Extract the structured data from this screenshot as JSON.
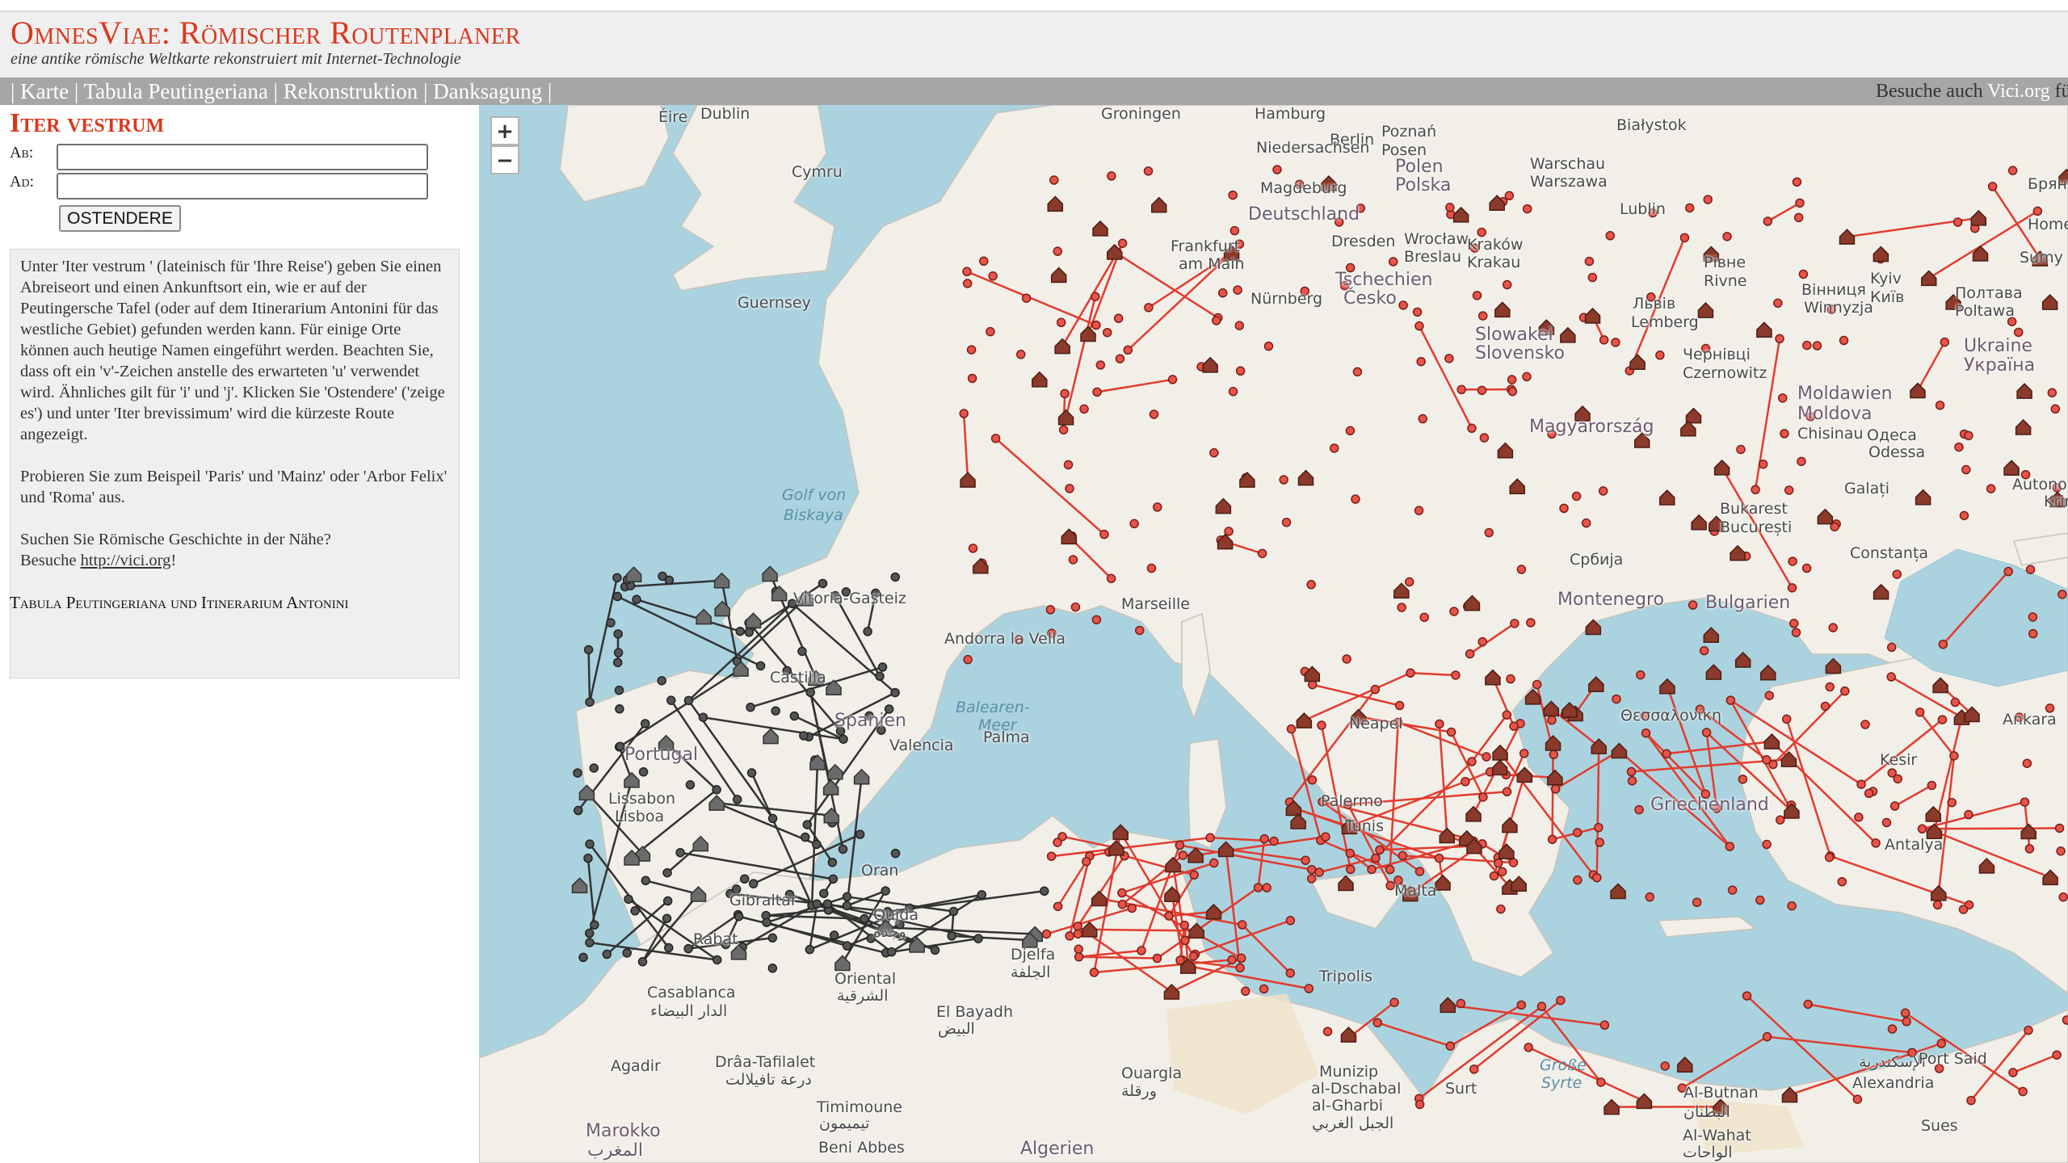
{
  "header": {
    "title": "OmnesViae: Römischer Routenplaner",
    "subtitle": "eine antike römische Weltkarte rekonstruiert mit Internet-Technologie"
  },
  "nav": {
    "separator": "|",
    "items": [
      "Karte",
      "Tabula Peutingeriana",
      "Rekonstruktion",
      "Danksagung"
    ],
    "right_text": "Besuche auch",
    "right_link": "Vici.org",
    "right_suffix": "fü"
  },
  "sidebar": {
    "heading": "Iter vestrum",
    "from_label": "Ab:",
    "to_label": "Ad:",
    "from_value": "",
    "to_value": "",
    "button": "OSTENDERE",
    "info_p1": "Unter 'Iter vestrum ' (lateinisch für 'Ihre Reise') geben Sie einen Abreiseort und einen Ankunftsort ein, wie er auf der Peutingersche Tafel (oder auf dem Itinerarium Antonini für das westliche Gebiet) gefunden werden kann. Für einige Orte können auch heutige Namen eingeführt werden. Beachten Sie, dass oft ein 'v'-Zeichen anstelle des erwarteten 'u' verwendet wird. Ähnliches gilt für 'i' und 'j'. Klicken Sie 'Ostendere' ('zeige es') und unter 'Iter brevissimum' wird die kürzeste Route angezeigt.",
    "info_p2": "Probieren Sie zum Beispeil 'Paris' und 'Mainz' oder 'Arbor Felix' und 'Roma' aus.",
    "info_p3a": "Suchen Sie Römische Geschichte in der Nähe?",
    "info_p3b": "Besuche",
    "info_link": "http://vici.org",
    "info_p3c": "!",
    "tabula_heading": "Tabula Peutingeriana und Itinerarium Antonini"
  },
  "map": {
    "zoom_in": "+",
    "zoom_out": "−",
    "colors": {
      "sea": "#aad3df",
      "land": "#f2efe9",
      "route": "#e23b2e",
      "station": "#c0392b",
      "ia_station": "#555555"
    },
    "labels": [
      {
        "text": "Éire"
      },
      {
        "text": "Dublin"
      },
      {
        "text": "Cymru"
      },
      {
        "text": "Groningen"
      },
      {
        "text": "Hamburg"
      },
      {
        "text": "Berlin"
      },
      {
        "text": "Poznań"
      },
      {
        "text": "Posen"
      },
      {
        "text": "Białystok"
      },
      {
        "text": "Niedersachsen"
      },
      {
        "text": "Magdeburg"
      },
      {
        "text": "Polen"
      },
      {
        "text": "Polska"
      },
      {
        "text": "Warschau"
      },
      {
        "text": "Warszawa"
      },
      {
        "text": "Deutschland"
      },
      {
        "text": "Dresden"
      },
      {
        "text": "Wrocław"
      },
      {
        "text": "Breslau"
      },
      {
        "text": "Lublin"
      },
      {
        "text": "Frankfurt"
      },
      {
        "text": "am Main"
      },
      {
        "text": "Kraków"
      },
      {
        "text": "Krakau"
      },
      {
        "text": "Nürnberg"
      },
      {
        "text": "Tschechien"
      },
      {
        "text": "Česko"
      },
      {
        "text": "Slowakei"
      },
      {
        "text": "Slovensko"
      },
      {
        "text": "Львів"
      },
      {
        "text": "Lemberg"
      },
      {
        "text": "Рівне"
      },
      {
        "text": "Rivne"
      },
      {
        "text": "Чернівці"
      },
      {
        "text": "Czernowitz"
      },
      {
        "text": "Magyarország"
      },
      {
        "text": "Moldawien"
      },
      {
        "text": "Moldova"
      },
      {
        "text": "Одеса"
      },
      {
        "text": "Odessa"
      },
      {
        "text": "Ukraine"
      },
      {
        "text": "Україна"
      },
      {
        "text": "Kyiv"
      },
      {
        "text": "Київ"
      },
      {
        "text": "Полтава"
      },
      {
        "text": "Poltawa"
      },
      {
        "text": "Вінниця"
      },
      {
        "text": "Winnyzja"
      },
      {
        "text": "Chisinau"
      },
      {
        "text": "Bukarest"
      },
      {
        "text": "București"
      },
      {
        "text": "Galați"
      },
      {
        "text": "Constanța"
      },
      {
        "text": "Bulgarien"
      },
      {
        "text": "Србија"
      },
      {
        "text": "Montenegro"
      },
      {
        "text": "Neapel"
      },
      {
        "text": "Palermo"
      },
      {
        "text": "Tunis"
      },
      {
        "text": "Malta"
      },
      {
        "text": "Tripolis"
      },
      {
        "text": "Guernsey"
      },
      {
        "text": "Vitoria-Gasteiz"
      },
      {
        "text": "Andorra la Vella"
      },
      {
        "text": "Marseille"
      },
      {
        "text": "Golf von"
      },
      {
        "text": "Biskaya"
      },
      {
        "text": "Balearen-"
      },
      {
        "text": "Meer"
      },
      {
        "text": "Palma"
      },
      {
        "text": "Valencia"
      },
      {
        "text": "Castilla"
      },
      {
        "text": "Spanien"
      },
      {
        "text": "Portugal"
      },
      {
        "text": "Lissabon"
      },
      {
        "text": "Lisboa"
      },
      {
        "text": "Gibraltar"
      },
      {
        "text": "Rabat"
      },
      {
        "text": "Casablanca"
      },
      {
        "text": "الدار البيضاء"
      },
      {
        "text": "Oran"
      },
      {
        "text": "Oujda"
      },
      {
        "text": "وجدة"
      },
      {
        "text": "Djelfa"
      },
      {
        "text": "الجلفة"
      },
      {
        "text": "El Bayadh"
      },
      {
        "text": "البيض"
      },
      {
        "text": "Oriental"
      },
      {
        "text": "الشرقية"
      },
      {
        "text": "Agadir"
      },
      {
        "text": "Drâa-Tafilalet"
      },
      {
        "text": "درعة تافيلالت"
      },
      {
        "text": "Marokko"
      },
      {
        "text": "المغرب"
      },
      {
        "text": "Timimoune"
      },
      {
        "text": "تيميمون"
      },
      {
        "text": "Ouargla"
      },
      {
        "text": "ورقلة"
      },
      {
        "text": "Algerien"
      },
      {
        "text": "Beni Abbes"
      },
      {
        "text": "Munizip"
      },
      {
        "text": "al-Dschabal"
      },
      {
        "text": "al-Gharbi"
      },
      {
        "text": "الجبل الغربي"
      },
      {
        "text": "Surt"
      },
      {
        "text": "Große"
      },
      {
        "text": "Syrte"
      },
      {
        "text": "Al-Butnan"
      },
      {
        "text": "البطنان"
      },
      {
        "text": "Al-Wahat"
      },
      {
        "text": "الواحات"
      },
      {
        "text": "الإسكندرية"
      },
      {
        "text": "Alexandria"
      },
      {
        "text": "Port Said"
      },
      {
        "text": "Kesir"
      },
      {
        "text": "Ankara"
      },
      {
        "text": "Antalya"
      },
      {
        "text": "Griechenland"
      },
      {
        "text": "Θεσσαλονίκη"
      },
      {
        "text": "Sues"
      },
      {
        "text": "Sumy"
      },
      {
        "text": "Homel"
      },
      {
        "text": "Брянская"
      },
      {
        "text": "Krim"
      },
      {
        "text": "Autonome"
      }
    ]
  }
}
